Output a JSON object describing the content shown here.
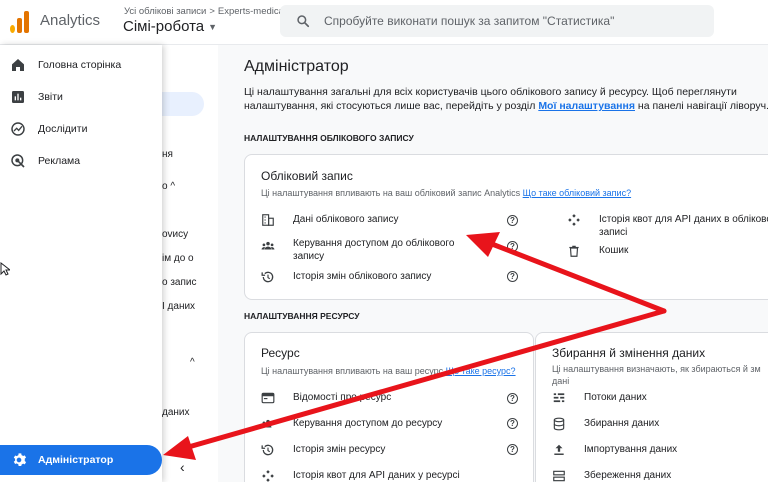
{
  "topbar": {
    "app_name": "Analytics",
    "account_crumb": "Усі облікові записи",
    "crumb_sep": ">",
    "account_name": "Experts-medical",
    "property_name": "Сімі-робота",
    "search_placeholder": "Спробуйте виконати пошук за запитом \"Статистика\""
  },
  "nav": {
    "items": [
      {
        "label": "Головна сторінка",
        "icon": "home-icon"
      },
      {
        "label": "Звіти",
        "icon": "bar-chart-icon"
      },
      {
        "label": "Дослідити",
        "icon": "explore-icon"
      },
      {
        "label": "Реклама",
        "icon": "ads-icon"
      }
    ],
    "admin_label": "Адміністратор"
  },
  "second_col": {
    "frag1": "ня",
    "frag2": "о ^",
    "frag3": "ovису",
    "frag4": "ім до о",
    "frag5": "о запис",
    "frag6": "I даних",
    "frag7": "даних"
  },
  "main": {
    "title": "Адміністратор",
    "intro_text": "Ці налаштування загальні для всіх користувачів цього облікового запису й ресурсу. Щоб переглянути налаштування, які стосуються лише вас, перейдіть у розділ ",
    "intro_link": "Мої налаштування",
    "intro_tail": " на панелі навігації ліворуч.",
    "account_section": "НАЛАШТУВАННЯ ОБЛІКОВОГО ЗАПИСУ",
    "account_card": {
      "title": "Обліковий запис",
      "subtitle": "Ці налаштування впливають на ваш обліковий запис Analytics ",
      "subtitle_link": "Що таке обліковий запис?",
      "left_items": [
        {
          "label": "Дані облікового запису",
          "icon": "building-icon"
        },
        {
          "label": "Керування доступом до облікового",
          "label2": "запису",
          "icon": "people-icon"
        },
        {
          "label": "Історія змін облікового запису",
          "icon": "history-icon"
        }
      ],
      "right_items": [
        {
          "label": "Історія квот для API даних в обліково",
          "label2": "записі",
          "icon": "api-icon"
        },
        {
          "label": "Кошик",
          "icon": "trash-icon"
        }
      ]
    },
    "property_section": "НАЛАШТУВАННЯ РЕСУРСУ",
    "property_card": {
      "title": "Ресурс",
      "subtitle": "Ці налаштування впливають на ваш ресурс ",
      "subtitle_link": "Що таке ресурс?",
      "items": [
        {
          "label": "Відомості про ресурс",
          "icon": "card-icon"
        },
        {
          "label": "Керування доступом до ресурсу",
          "icon": "people-icon"
        },
        {
          "label": "Історія змін ресурсу",
          "icon": "history-icon"
        },
        {
          "label": "Історія квот для API даних у ресурсі",
          "icon": "api-icon"
        }
      ]
    },
    "data_card": {
      "title": "Збирання й змінення даних",
      "subtitle": "Ці налаштування визначають, як збираються й зм",
      "subtitle2": "дані",
      "items": [
        {
          "label": "Потоки даних",
          "icon": "streams-icon"
        },
        {
          "label": "Збирання даних",
          "icon": "database-icon"
        },
        {
          "label": "Імпортування даних",
          "icon": "upload-icon"
        },
        {
          "label": "Збереження даних",
          "icon": "storage-icon"
        }
      ]
    }
  },
  "colors": {
    "accent": "#1a73e8",
    "arrow": "#e8141b"
  }
}
